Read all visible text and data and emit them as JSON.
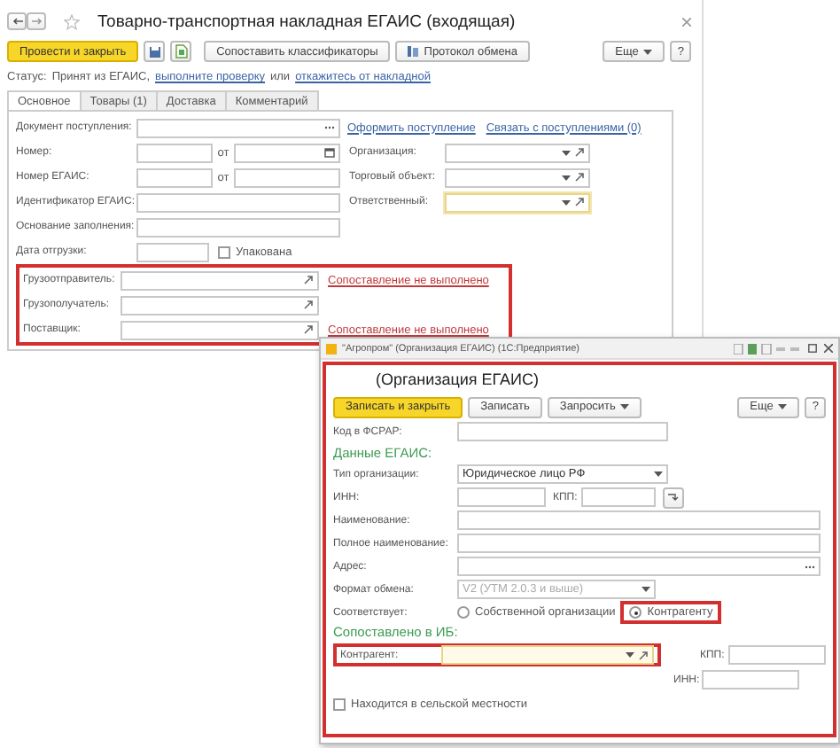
{
  "main_window": {
    "title": "Товарно-транспортная накладная ЕГАИС (входящая)",
    "toolbar": {
      "post_close": "Провести и закрыть",
      "match_classifiers": "Сопоставить классификаторы",
      "exchange_log": "Протокол обмена",
      "more": "Еще",
      "help": "?"
    },
    "status": {
      "label": "Статус:",
      "text": "Принят из ЕГАИС,",
      "check_link": "выполните проверку",
      "or": "или",
      "refuse_link": "откажитесь от накладной"
    },
    "tabs": [
      {
        "label": "Основное",
        "selected": true
      },
      {
        "label": "Товары (1)",
        "selected": false
      },
      {
        "label": "Доставка",
        "selected": false
      },
      {
        "label": "Комментарий",
        "selected": false
      }
    ],
    "receipt_doc": {
      "label": "Документ поступления:",
      "create_link": "Оформить поступление",
      "bind_link": "Связать с поступлениями (0)"
    },
    "number": {
      "label": "Номер:",
      "date_label": "от"
    },
    "egais_number": {
      "label": "Номер ЕГАИС:",
      "date_label": "от"
    },
    "egais_id": {
      "label": "Идентификатор ЕГАИС:"
    },
    "basis": {
      "label": "Основание заполнения:"
    },
    "ship_date": {
      "label": "Дата отгрузки:"
    },
    "packed": {
      "label": "Упакована",
      "checked": false
    },
    "organization": {
      "label": "Организация:"
    },
    "trade_object": {
      "label": "Торговый объект:"
    },
    "responsible": {
      "label": "Ответственный:"
    },
    "parties": [
      {
        "label": "Грузоотправитель:",
        "status": "Сопоставление не выполнено"
      },
      {
        "label": "Грузополучатель:"
      },
      {
        "label": "Поставщик:",
        "status": "Сопоставление не выполнено"
      }
    ]
  },
  "org_window": {
    "window_title": "\"Агропром\" (Организация ЕГАИС) (1С:Предприятие)",
    "heading": "(Организация ЕГАИС)",
    "toolbar": {
      "save_close": "Записать и закрыть",
      "save": "Записать",
      "request": "Запросить",
      "more": "Еще",
      "help": "?"
    },
    "fsrar": {
      "label": "Код в ФСРАР:"
    },
    "egais_section": "Данные ЕГАИС:",
    "org_type": {
      "label": "Тип организации:",
      "value": "Юридическое лицо РФ"
    },
    "inn": {
      "label": "ИНН:"
    },
    "kpp": {
      "label": "КПП:"
    },
    "name": {
      "label": "Наименование:"
    },
    "full_name": {
      "label": "Полное наименование:"
    },
    "address": {
      "label": "Адрес:"
    },
    "format": {
      "label": "Формат обмена:",
      "value": "V2 (УТМ 2.0.3 и выше)",
      "disabled": true
    },
    "match": {
      "label": "Соответствует:",
      "options": [
        {
          "label": "Собственной организации",
          "selected": false
        },
        {
          "label": "Контрагенту",
          "selected": true
        }
      ]
    },
    "ib_section": "Сопоставлено в ИБ:",
    "counterparty": {
      "label": "Контрагент:"
    },
    "cp_kpp": {
      "label": "КПП:"
    },
    "cp_inn": {
      "label": "ИНН:"
    },
    "rural": {
      "label": "Находится в сельской местности",
      "checked": false
    }
  }
}
